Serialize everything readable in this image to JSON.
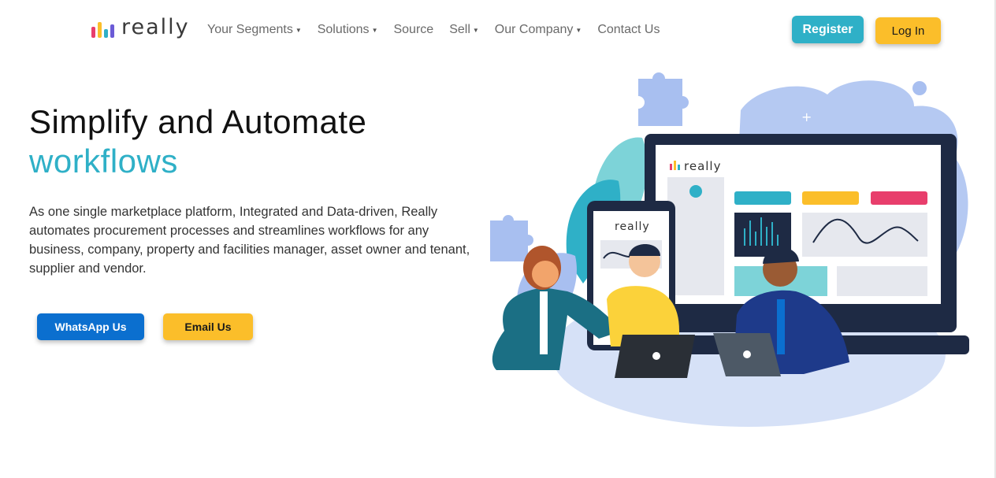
{
  "brand": {
    "name": "really",
    "bar_colors": [
      "#e83e6c",
      "#fbbe2a",
      "#2fb0c7",
      "#6b5bd6"
    ]
  },
  "nav": {
    "items": [
      {
        "label": "Your Segments",
        "dropdown": true
      },
      {
        "label": "Solutions",
        "dropdown": true
      },
      {
        "label": "Source",
        "dropdown": false
      },
      {
        "label": "Sell",
        "dropdown": true
      },
      {
        "label": "Our Company",
        "dropdown": true
      },
      {
        "label": "Contact Us",
        "dropdown": false
      }
    ]
  },
  "header": {
    "register_label": "Register",
    "login_label": "Log In"
  },
  "hero": {
    "title_line1": "Simplify and Automate",
    "title_line2": "workflows",
    "description": "As one single marketplace platform, Integrated and Data-driven, Really automates procurement processes and streamlines workflows for any business, company, property and facilities manager, asset owner and tenant, supplier and vendor.",
    "whatsapp_label": "WhatsApp Us",
    "email_label": "Email Us"
  },
  "illustration": {
    "monitor_logo": "really",
    "phone_logo": "really"
  },
  "colors": {
    "accent": "#2fb0c7",
    "primary_blue": "#0b6fcf",
    "yellow": "#fbbe2a",
    "pink": "#e83e6c"
  }
}
